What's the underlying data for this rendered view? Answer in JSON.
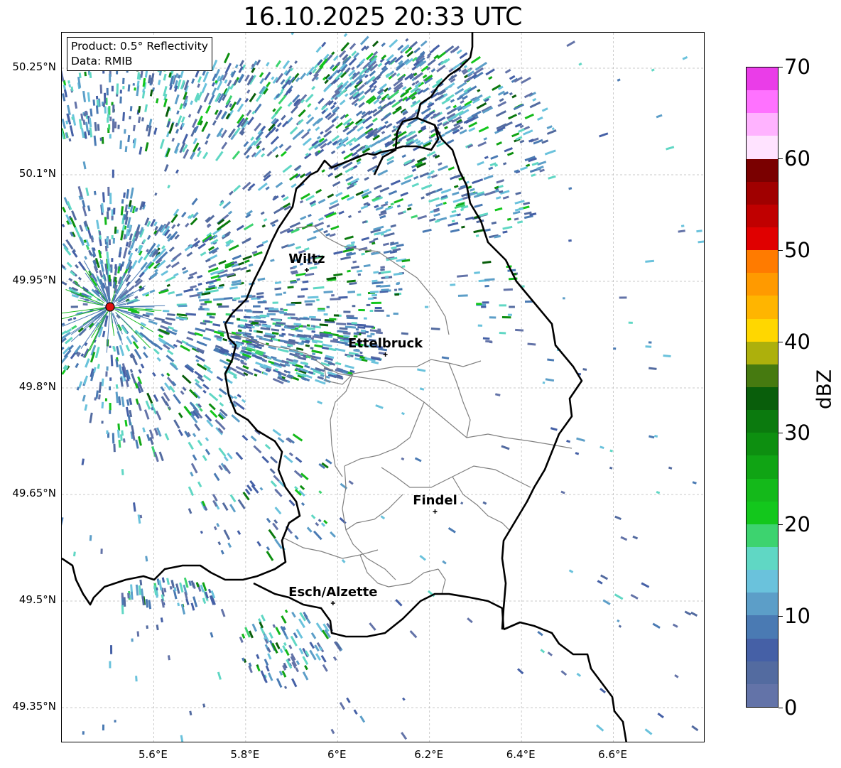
{
  "title": "16.10.2025 20:33 UTC",
  "info": {
    "product": "Product: 0.5° Reflectivity",
    "data": "Data: RMIB"
  },
  "map": {
    "lon_range": [
      5.4,
      6.8
    ],
    "lat_range": [
      49.3,
      50.3
    ],
    "x_ticks": [
      "5.6°E",
      "5.8°E",
      "6°E",
      "6.2°E",
      "6.4°E",
      "6.6°E"
    ],
    "y_ticks": [
      "50.25°N",
      "50.1°N",
      "49.95°N",
      "49.8°N",
      "49.65°N",
      "49.5°N",
      "49.35°N"
    ],
    "radar_site": {
      "lon": 5.505,
      "lat": 49.914
    },
    "cities": [
      {
        "name": "Wiltz",
        "lon": 5.933,
        "lat": 49.966
      },
      {
        "name": "Ettelbruck",
        "lon": 6.104,
        "lat": 49.847
      },
      {
        "name": "Findel",
        "lon": 6.212,
        "lat": 49.626
      },
      {
        "name": "Esch/Alzette",
        "lon": 5.99,
        "lat": 49.497
      }
    ]
  },
  "colorbar": {
    "label": "dBZ",
    "min": 0,
    "max": 70,
    "ticks": [
      "0",
      "10",
      "20",
      "30",
      "40",
      "50",
      "60",
      "70"
    ],
    "colors": [
      "#6373a8",
      "#536ba0",
      "#4560a6",
      "#4a7ab3",
      "#5c9ec8",
      "#6ac2dc",
      "#60d7c4",
      "#3dd36f",
      "#13c71c",
      "#14b91a",
      "#10a414",
      "#0d8f10",
      "#0b7a0e",
      "#095e0b",
      "#467a10",
      "#adb00c",
      "#ffd700",
      "#ffb500",
      "#ff9a00",
      "#ff7b00",
      "#e00000",
      "#c00000",
      "#a00000",
      "#7a0000",
      "#ffe3ff",
      "#ffb3ff",
      "#ff72ff",
      "#ea3de8"
    ]
  }
}
